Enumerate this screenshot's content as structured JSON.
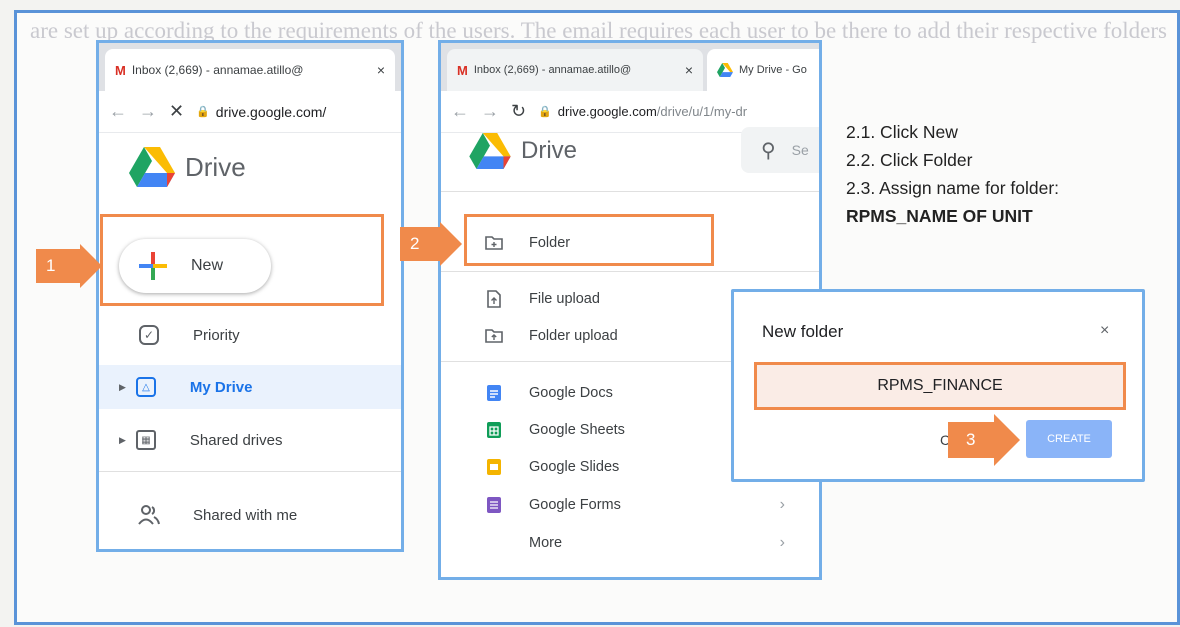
{
  "background_text": "are set up according to the requirements of the users. The email requires each user to be there to add their respective folders for the different configurations of the entity's employees so that each of their agents can take one with them.",
  "window1": {
    "tab_label": "Inbox (2,669) - annamae.atillo@",
    "tab_close": "×",
    "url": "drive.google.com/",
    "brand": "Drive",
    "new_button": "New",
    "nav": [
      {
        "label": "Priority"
      },
      {
        "label": "My Drive"
      },
      {
        "label": "Shared drives"
      },
      {
        "label": "Shared with me"
      }
    ]
  },
  "window2": {
    "tab1_label": "Inbox (2,669) - annamae.atillo@",
    "tab1_close": "×",
    "tab2_label": "My Drive - Go",
    "url_host": "drive.google.com",
    "url_path": "/drive/u/1/my-dr",
    "brand": "Drive",
    "search_hint": "Se",
    "menu": [
      {
        "label": "Folder"
      },
      {
        "label": "File upload"
      },
      {
        "label": "Folder upload"
      },
      {
        "label": "Google Docs"
      },
      {
        "label": "Google Sheets"
      },
      {
        "label": "Google Slides"
      },
      {
        "label": "Google Forms"
      },
      {
        "label": "More"
      }
    ],
    "chevron": "›"
  },
  "instructions": {
    "step1": "2.1. Click New",
    "step2": "2.2. Click Folder",
    "step3": "2.3. Assign name for folder:",
    "folder_format": "RPMS_NAME OF UNIT"
  },
  "dialog": {
    "title": "New folder",
    "close": "×",
    "input_value": "RPMS_FINANCE",
    "cancel_partial": "C",
    "create_label": "CREATE"
  },
  "callouts": {
    "one": "1",
    "two": "2",
    "three": "3"
  },
  "colors": {
    "accent_orange": "#f08a4b",
    "frame_blue": "#5a93d8",
    "drive_blue": "#1a73e8",
    "create_blue": "#8ab4f8"
  }
}
